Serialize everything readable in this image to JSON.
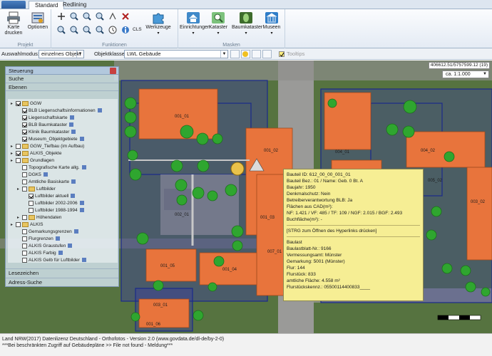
{
  "tabs": [
    {
      "label": "Standard",
      "active": true
    },
    {
      "label": "Redlining",
      "active": false
    }
  ],
  "ribbon": {
    "groups": [
      {
        "name": "projekt",
        "label": "Projekt"
      },
      {
        "name": "funktionen",
        "label": "Funktionen"
      },
      {
        "name": "masken",
        "label": "Masken"
      }
    ],
    "buttons": {
      "karte_drucken": "Karte drucken",
      "optionen": "Optionen",
      "cls": "CLS",
      "werkzeuge": "Werkzeuge",
      "einrichtungen": "Einrichtungen",
      "kataster": "Kataster",
      "baumkataster": "Baumkataster",
      "museen": "Museen"
    }
  },
  "selbar": {
    "auswahlmodus_label": "Auswahlmodus:",
    "auswahlmodus_value": "einzelnes Objekt",
    "objektklasse_label": "Objektklasse:",
    "objektklasse_value": "LWL Gebäude",
    "tooltips_label": "Tooltips"
  },
  "map": {
    "coord_readout": "406612.51/5757599.12 (19)",
    "scale": "ca. 1:1.000",
    "building_labels": [
      "001_01",
      "001_02",
      "001_03",
      "001_04",
      "001_05",
      "001_06",
      "004_01",
      "004_02",
      "003_01",
      "003_02",
      "005_01",
      "005_02",
      "007_01",
      "002_01"
    ],
    "colors": {
      "roof": "#e8743c",
      "parcel_outline": "#1a2a8a",
      "tree": "#2fa62f",
      "tooltip_bg": "#f6ee94"
    }
  },
  "panel": {
    "title": "Steuerung",
    "sections": {
      "suche": "Suche",
      "ebenen": "Ebenen",
      "lesezeichen": "Lesezeichen",
      "adress_suche": "Adress-Suche"
    },
    "tree": [
      {
        "label": "GGW",
        "level": 0,
        "type": "folder",
        "checked": true
      },
      {
        "label": "BLB Liegenschaftsinformationen",
        "level": 1,
        "checked": true
      },
      {
        "label": "Liegenschaftskarte",
        "level": 1,
        "checked": true
      },
      {
        "label": "BLB Baumkataster",
        "level": 1,
        "checked": true
      },
      {
        "label": "Klinik Baumkataster",
        "level": 1,
        "checked": true
      },
      {
        "label": "Museum_Objektgebiete",
        "level": 1,
        "checked": true
      },
      {
        "label": "GGW_Tiefbau (im Aufbau)",
        "level": 0,
        "type": "folder",
        "checked": false
      },
      {
        "label": "ALKIS_Objekte",
        "level": 0,
        "type": "folder",
        "checked": true
      },
      {
        "label": "Grundlagen",
        "level": 0,
        "type": "folder",
        "checked": false
      },
      {
        "label": "Topografische Karte allg.",
        "level": 1,
        "checked": false
      },
      {
        "label": "DGK5",
        "level": 1,
        "checked": false
      },
      {
        "label": "Amtliche Basiskarte",
        "level": 1,
        "checked": false
      },
      {
        "label": "Luftbilder",
        "level": 1,
        "type": "folder",
        "checked": false
      },
      {
        "label": "Luftbilder aktuell",
        "level": 2,
        "checked": true
      },
      {
        "label": "Luftbilder 2002-2006",
        "level": 2,
        "checked": false
      },
      {
        "label": "Luftbilder 1988-1994",
        "level": 2,
        "checked": false
      },
      {
        "label": "Höhendaten",
        "level": 1,
        "type": "folder",
        "checked": false
      },
      {
        "label": "ALKIS",
        "level": 0,
        "type": "folder",
        "checked": false
      },
      {
        "label": "Gemarkungsgrenzen",
        "level": 1,
        "checked": false
      },
      {
        "label": "Flurgrenzen",
        "level": 1,
        "checked": false
      },
      {
        "label": "ALKIS Graustufen",
        "level": 1,
        "checked": false
      },
      {
        "label": "ALKIS Farbig",
        "level": 1,
        "checked": false
      },
      {
        "label": "ALKIS Gelb für Luftbilder",
        "level": 1,
        "checked": false
      }
    ]
  },
  "tooltip": {
    "lines": [
      "Bauteil ID: 612_00_00_001_01",
      "Bauteil Bez.: 01 / Name: Geb. 0 Bt. A",
      "Baujahr: 1950",
      "Denkmalschutz: Nein",
      "Betreiberverantwortung BLB: Ja",
      "Flächen aus CAD(m²):",
      "NF:  1.421 / VF:    485 / TF:    109 / NGF:  2.015 / BGF:  2.493",
      "Buchfläche(m²): -"
    ],
    "hyperlink_hint": "[STRG zum Öffnen des Hyperlinks drücken]",
    "lines2": [
      "Baulast",
      "Baulastblatt-Nr.: 9166",
      "Vermessungsamt: Münster",
      "Gemarkung: 5001 (Münster)",
      "Flur: 144",
      "Flurstück: 833",
      "amtliche Fläche:            4.558 m²",
      "Flurstückskennz.: 05500114400833____"
    ]
  },
  "status": {
    "line1": "Land NRW(2017) Datenlizenz Deutschland - Orthofotos - Version 2.0 (www.govdata.de/dl-de/by-2-0)",
    "line2": "***Bei beschränkten Zugriff auf Gebäudepläne >> File not found - Meldung***"
  }
}
